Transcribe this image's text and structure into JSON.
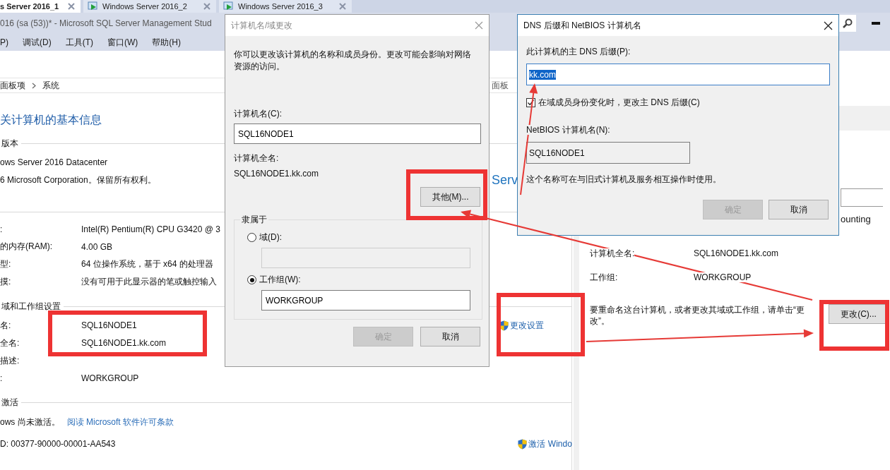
{
  "tabs": [
    {
      "label": "s Server 2016_1",
      "selected": true
    },
    {
      "label": "Windows Server 2016_2",
      "selected": false
    },
    {
      "label": "Windows Server 2016_3",
      "selected": false
    }
  ],
  "window": {
    "title": "016 (sa (53))* - Microsoft SQL Server Management Stud"
  },
  "menu": [
    "P)",
    "调试(D)",
    "工具(T)",
    "窗口(W)",
    "帮助(H)"
  ],
  "breadcrumb": {
    "items": [
      "面板项",
      "系统"
    ],
    "right_text": "面板"
  },
  "system": {
    "heading": "关计算机的基本信息",
    "edition": {
      "title": "版本",
      "lines": [
        "ows Server 2016 Datacenter",
        "6 Microsoft Corporation。保留所有权利。"
      ],
      "logo_text": "Serv"
    },
    "hardware": {
      "rows": [
        {
          "label": ":",
          "value": "Intel(R) Pentium(R) CPU G3420 @ 3"
        },
        {
          "label": "的内存(RAM):",
          "value": "4.00 GB"
        },
        {
          "label": "型:",
          "value": "64 位操作系统，基于 x64 的处理器"
        },
        {
          "label": "摸:",
          "value": "没有可用于此显示器的笔或触控输入"
        }
      ]
    },
    "computer": {
      "title": "域和工作组设置",
      "action": "更改设置",
      "rows": [
        {
          "label": "名:",
          "value": "SQL16NODE1"
        },
        {
          "label": "全名:",
          "value": "SQL16NODE1.kk.com"
        },
        {
          "label": "描述:"
        },
        {
          "label": ":",
          "value": "WORKGROUP"
        }
      ]
    },
    "activation": {
      "title": "激活",
      "status": "ows 尚未激活。",
      "link": "阅读 Microsoft 软件许可条款",
      "product_id": "D: 00377-90000-00001-AA543",
      "action": "激活 Windo"
    }
  },
  "properties_panel": {
    "name_suffix": "ounting",
    "rows": [
      {
        "label": "计算机全名:",
        "value": "SQL16NODE1.kk.com"
      },
      {
        "label": "工作组:",
        "value": "WORKGROUP"
      }
    ],
    "hint": "要重命名这台计算机，或者更改其域或工作组，请单击“更改”。",
    "button": "更改(C)..."
  },
  "name_dialog": {
    "title": "计算机名/域更改",
    "description": "你可以更改该计算机的名称和成员身份。更改可能会影响对网络资源的访问。",
    "name_label": "计算机名(C):",
    "name_value": "SQL16NODE1",
    "full_name_label": "计算机全名:",
    "full_name": "SQL16NODE1.kk.com",
    "more_button": "其他(M)...",
    "member_of": {
      "title": "隶属于",
      "options": [
        {
          "label": "域(D):",
          "selected": false
        },
        {
          "label": "工作组(W):",
          "selected": true,
          "value": "WORKGROUP"
        }
      ]
    },
    "buttons": [
      {
        "label": "确定",
        "disabled": true
      },
      {
        "label": "取消",
        "disabled": false
      }
    ]
  },
  "dns_dialog": {
    "title": "DNS 后缀和 NetBIOS 计算机名",
    "suffix_label": "此计算机的主 DNS 后缀(P):",
    "suffix": {
      "value": "kk.com",
      "highlighted": true
    },
    "change_on_membership": {
      "label": "在域成员身份变化时，更改主 DNS 后缀(C)",
      "checked": true
    },
    "netbios_label": "NetBIOS 计算机名(N):",
    "netbios_name": "SQL16NODE1",
    "note": "这个名称可在与旧式计算机及服务相互操作时使用。",
    "buttons": [
      {
        "label": "确定",
        "disabled": true
      },
      {
        "label": "取消",
        "disabled": false
      }
    ]
  }
}
